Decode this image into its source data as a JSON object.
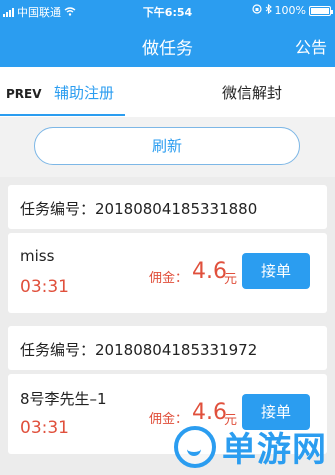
{
  "status_bar": {
    "carrier": "中国联通",
    "time": "下午6:54",
    "battery": "100%"
  },
  "nav": {
    "title": "做任务",
    "right_action": "公告"
  },
  "tabs": {
    "prev": "PREV",
    "active": "辅助注册",
    "other": "微信解封"
  },
  "refresh_label": "刷新",
  "commission_label": "佣金：",
  "commission_unit": "元",
  "accept_label": "接单",
  "tasks": [
    {
      "id_label": "任务编号：",
      "id": "20180804185331880",
      "name": "miss",
      "time": "03:31",
      "commission": "4.6"
    },
    {
      "id_label": "任务编号：",
      "id": "20180804185331972",
      "name": "8号李先生–1",
      "time": "03:31",
      "commission": "4.6"
    }
  ],
  "watermark": "单游网",
  "colors": {
    "primary": "#2b9df0",
    "accent_red": "#e0503c",
    "background": "#ececec"
  }
}
